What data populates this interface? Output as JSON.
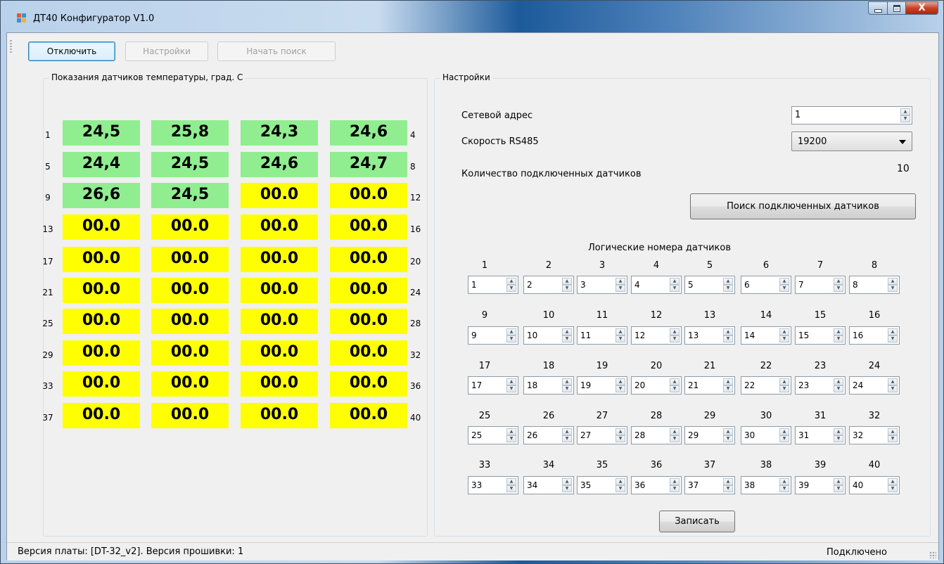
{
  "window": {
    "title": "ДТ40 Конфигуратор V1.0",
    "close_glyph": "X"
  },
  "toolbar": {
    "disconnect_label": "Отключить",
    "settings_label": "Настройки",
    "start_search_label": "Начать поиск"
  },
  "temps": {
    "title": "Показания датчиков температуры,  град. С",
    "colors": {
      "ok": "#90ee90",
      "none": "#ffff00"
    },
    "rows": [
      {
        "first": "1",
        "last": "4",
        "values": [
          "24,5",
          "25,8",
          "24,3",
          "24,6"
        ],
        "status": [
          "ok",
          "ok",
          "ok",
          "ok"
        ]
      },
      {
        "first": "5",
        "last": "8",
        "values": [
          "24,4",
          "24,5",
          "24,6",
          "24,7"
        ],
        "status": [
          "ok",
          "ok",
          "ok",
          "ok"
        ]
      },
      {
        "first": "9",
        "last": "12",
        "values": [
          "26,6",
          "24,5",
          "00.0",
          "00.0"
        ],
        "status": [
          "ok",
          "ok",
          "none",
          "none"
        ]
      },
      {
        "first": "13",
        "last": "16",
        "values": [
          "00.0",
          "00.0",
          "00.0",
          "00.0"
        ],
        "status": [
          "none",
          "none",
          "none",
          "none"
        ]
      },
      {
        "first": "17",
        "last": "20",
        "values": [
          "00.0",
          "00.0",
          "00.0",
          "00.0"
        ],
        "status": [
          "none",
          "none",
          "none",
          "none"
        ]
      },
      {
        "first": "21",
        "last": "24",
        "values": [
          "00.0",
          "00.0",
          "00.0",
          "00.0"
        ],
        "status": [
          "none",
          "none",
          "none",
          "none"
        ]
      },
      {
        "first": "25",
        "last": "28",
        "values": [
          "00.0",
          "00.0",
          "00.0",
          "00.0"
        ],
        "status": [
          "none",
          "none",
          "none",
          "none"
        ]
      },
      {
        "first": "29",
        "last": "32",
        "values": [
          "00.0",
          "00.0",
          "00.0",
          "00.0"
        ],
        "status": [
          "none",
          "none",
          "none",
          "none"
        ]
      },
      {
        "first": "33",
        "last": "36",
        "values": [
          "00.0",
          "00.0",
          "00.0",
          "00.0"
        ],
        "status": [
          "none",
          "none",
          "none",
          "none"
        ]
      },
      {
        "first": "37",
        "last": "40",
        "values": [
          "00.0",
          "00.0",
          "00.0",
          "00.0"
        ],
        "status": [
          "none",
          "none",
          "none",
          "none"
        ]
      }
    ]
  },
  "settings": {
    "title": "Настройки",
    "net_address_label": "Сетевой адрес",
    "net_address_value": "1",
    "speed_label": "Скорость RS485",
    "speed_value": "19200",
    "count_label": "Количество подключенных датчиков",
    "count_value": "10",
    "search_button_label": "Поиск подключенных датчиков",
    "logical_title": "Логические номера датчиков",
    "logical_labels": [
      "1",
      "2",
      "3",
      "4",
      "5",
      "6",
      "7",
      "8",
      "9",
      "10",
      "11",
      "12",
      "13",
      "14",
      "15",
      "16",
      "17",
      "18",
      "19",
      "20",
      "21",
      "22",
      "23",
      "24",
      "25",
      "26",
      "27",
      "28",
      "29",
      "30",
      "31",
      "32",
      "33",
      "34",
      "35",
      "36",
      "37",
      "38",
      "39",
      "40"
    ],
    "logical_values": [
      "1",
      "2",
      "3",
      "4",
      "5",
      "6",
      "7",
      "8",
      "9",
      "10",
      "11",
      "12",
      "13",
      "14",
      "15",
      "16",
      "17",
      "18",
      "19",
      "20",
      "21",
      "22",
      "23",
      "24",
      "25",
      "26",
      "27",
      "28",
      "29",
      "30",
      "31",
      "32",
      "33",
      "34",
      "35",
      "36",
      "37",
      "38",
      "39",
      "40"
    ],
    "write_button_label": "Записать"
  },
  "statusbar": {
    "board_info": "Версия платы: [DT-32_v2]. Версия прошивки: 1",
    "connection": "Подключено"
  }
}
